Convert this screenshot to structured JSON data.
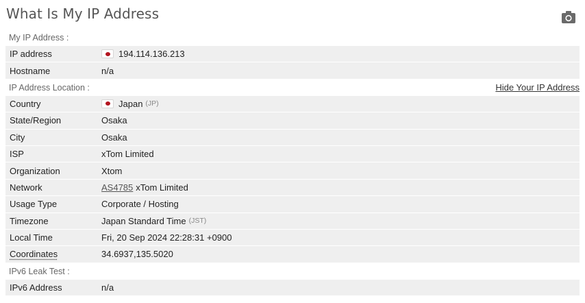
{
  "page": {
    "title": "What Is My IP Address",
    "camera_icon": "camera-icon"
  },
  "sections": {
    "my_ip": "My IP Address :",
    "location": "IP Address Location :",
    "hide_link": "Hide Your IP Address",
    "ipv6": "IPv6 Leak Test :"
  },
  "rows": {
    "ip": {
      "label": "IP address",
      "value": "194.114.136.213",
      "flag": "japan-flag-icon"
    },
    "hostname": {
      "label": "Hostname",
      "value": "n/a"
    },
    "country": {
      "label": "Country",
      "value": "Japan",
      "code": "(JP)",
      "flag": "japan-flag-icon"
    },
    "state": {
      "label": "State/Region",
      "value": "Osaka"
    },
    "city": {
      "label": "City",
      "value": "Osaka"
    },
    "isp": {
      "label": "ISP",
      "value": "xTom Limited"
    },
    "org": {
      "label": "Organization",
      "value": "Xtom"
    },
    "network": {
      "label": "Network",
      "as_link": "AS4785",
      "value": "xTom Limited"
    },
    "usage": {
      "label": "Usage Type",
      "value": "Corporate / Hosting"
    },
    "timezone": {
      "label": "Timezone",
      "value": "Japan Standard Time",
      "code": "(JST)"
    },
    "local_time": {
      "label": "Local Time",
      "value": "Fri, 20 Sep 2024 22:28:31 +0900"
    },
    "coords": {
      "label": "Coordinates",
      "value": "34.6937,135.5020"
    },
    "ipv6": {
      "label": "IPv6 Address",
      "value": "n/a"
    }
  },
  "colors": {
    "title": "#555555",
    "row_bg": "#efefef",
    "flag_red": "#b3141f"
  }
}
